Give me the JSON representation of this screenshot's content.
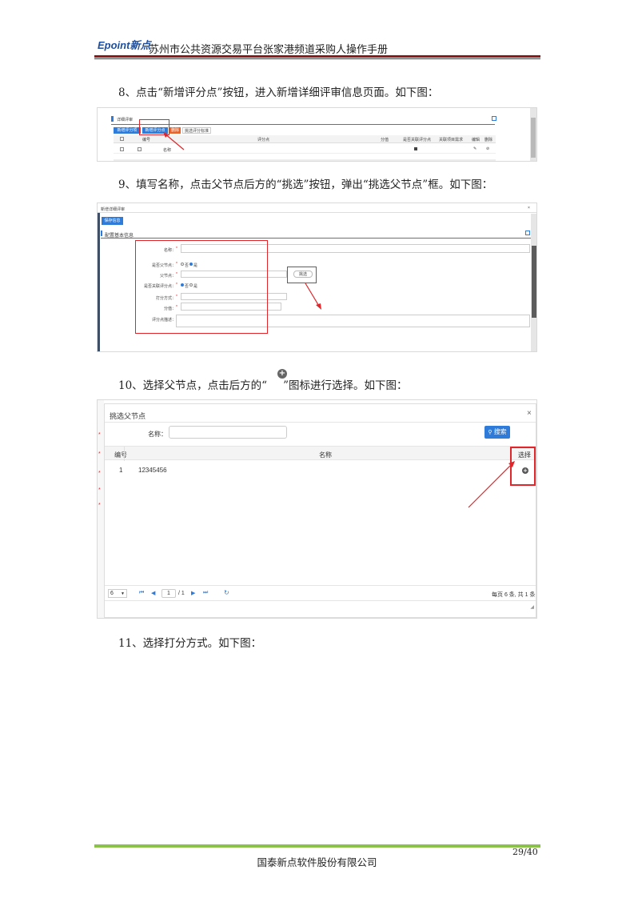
{
  "header": {
    "logo_en": "Epoint",
    "logo_cn": "新点",
    "title": "苏州市公共资源交易平台张家港频道采购人操作手册"
  },
  "steps": {
    "s8": "8、点击“新增评分点”按钮，进入新增详细评审信息页面。如下图：",
    "s9": "9、填写名称，点击父节点后方的“挑选”按钮，弹出“挑选父节点”框。如下图：",
    "s10_before": "10、选择父节点，点击后方的“",
    "s10_after": "”图标进行选择。如下图：",
    "s11": "11、选择打分方式。如下图："
  },
  "shot1": {
    "panel_title": "详细评审",
    "toolbar": [
      "新增评分项",
      "新增评分点",
      "删除",
      "挑选评分标准"
    ],
    "columns": [
      "编号",
      "评分点",
      "分值",
      "是否关联评分点",
      "关联项目需求",
      "编辑",
      "删除"
    ],
    "row": {
      "name": "名称"
    }
  },
  "shot2": {
    "window_title": "新增详细评审",
    "save_button": "保存信息",
    "section_title": "配置基本信息",
    "fields": [
      "名称：",
      "是否父节点：",
      "父节点：",
      "是否关联评分点：",
      "打分方式：",
      "分值：",
      "评分点描述："
    ],
    "pick_button": "挑选",
    "radio_labels": [
      "否",
      "是"
    ]
  },
  "shot3": {
    "dialog_title": "挑选父节点",
    "search_label": "名称：",
    "search_placeholder": "",
    "search_button": "搜索",
    "columns": [
      "编号",
      "名称",
      "选择"
    ],
    "rows": [
      {
        "no": "1",
        "name": "12345456"
      }
    ],
    "page_size": "6",
    "page_current": "1",
    "page_total": "/ 1",
    "summary": "每页 6 条, 共 1 条"
  },
  "footer": {
    "page": "29/40",
    "company": "国泰新点软件股份有限公司"
  },
  "colors": {
    "brand_red": "#8b1b1b",
    "accent_blue": "#2f7bd9",
    "highlight_red": "#e0262a",
    "footer_green": "#8bc34a"
  }
}
